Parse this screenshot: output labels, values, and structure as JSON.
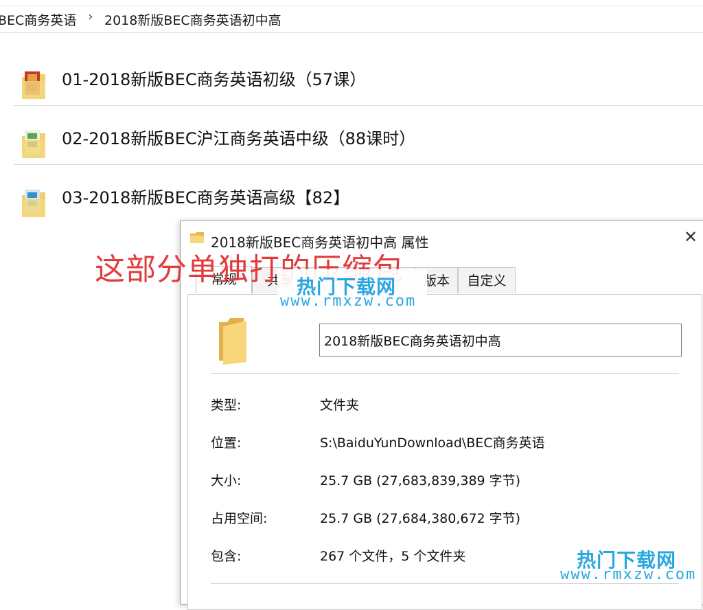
{
  "breadcrumb": {
    "items": [
      "BEC商务英语",
      "2018新版BEC商务英语初中高"
    ],
    "separator": "›"
  },
  "folders": [
    {
      "name": "01-2018新版BEC商务英语初级（57课）",
      "icon": "folder-thumbnail-icon"
    },
    {
      "name": "02-2018新版BEC沪江商务英语中级（88课时）",
      "icon": "folder-thumbnail-icon"
    },
    {
      "name": "03-2018新版BEC商务英语高级【82】",
      "icon": "folder-thumbnail-icon"
    }
  ],
  "dialog": {
    "title": "2018新版BEC商务英语初中高 属性",
    "close_glyph": "✕",
    "tabs": [
      "常规",
      "共享",
      "",
      "版本",
      "自定义"
    ],
    "active_tab": "常规",
    "name_value": "2018新版BEC商务英语初中高",
    "properties": [
      {
        "label": "类型:",
        "value": "文件夹"
      },
      {
        "label": "位置:",
        "value": "S:\\BaiduYunDownload\\BEC商务英语"
      },
      {
        "label": "大小:",
        "value": "25.7 GB (27,683,839,389 字节)"
      },
      {
        "label": "占用空间:",
        "value": "25.7 GB (27,684,380,672 字节)"
      },
      {
        "label": "包含:",
        "value": "267 个文件，5 个文件夹"
      }
    ]
  },
  "annotation": {
    "text": "这部分单独打的压缩包",
    "color": "#e23b3b"
  },
  "watermarks": [
    {
      "cn": "热门下载网",
      "url": "www.rmxzw.com"
    },
    {
      "cn": "热门下载网",
      "url": "www.rmxzw.com"
    }
  ],
  "colors": {
    "folder_yellow": "#f2cf6b",
    "watermark_blue": "#2aa7e0"
  }
}
